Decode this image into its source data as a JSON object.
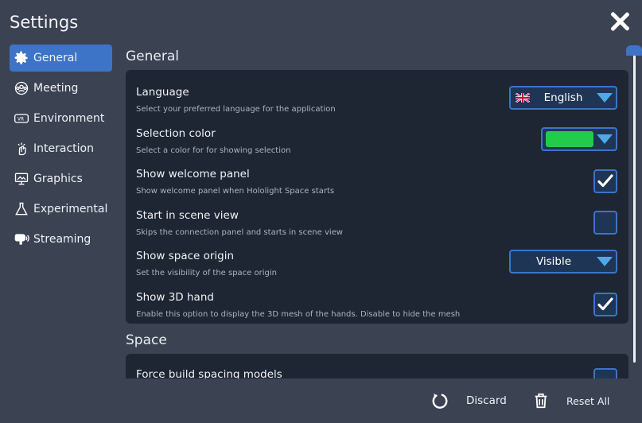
{
  "window": {
    "title": "Settings"
  },
  "sidebar": {
    "items": [
      {
        "label": "General",
        "icon": "gear-icon",
        "active": true
      },
      {
        "label": "Meeting",
        "icon": "meeting-icon"
      },
      {
        "label": "Environment",
        "icon": "vr-headset-icon"
      },
      {
        "label": "Interaction",
        "icon": "interaction-icon"
      },
      {
        "label": "Graphics",
        "icon": "monitor-icon"
      },
      {
        "label": "Experimental",
        "icon": "flask-icon"
      },
      {
        "label": "Streaming",
        "icon": "streaming-icon"
      }
    ]
  },
  "general": {
    "title": "General",
    "rows": [
      {
        "label": "Language",
        "desc": "Select your preferred language for the application",
        "control": "dropdown",
        "value": "English",
        "flag": "uk-flag-icon"
      },
      {
        "label": "Selection color",
        "desc": "Select a color for for showing selection",
        "control": "color",
        "value": "#22cc4a"
      },
      {
        "label": "Show welcome panel",
        "desc": "Show welcome panel when Hololight Space starts",
        "control": "checkbox",
        "checked": true
      },
      {
        "label": "Start in scene view",
        "desc": "Skips the connection panel and starts in scene view",
        "control": "checkbox",
        "checked": false
      },
      {
        "label": "Show space origin",
        "desc": "Set the visibility of the space origin",
        "control": "dropdown",
        "value": "Visible"
      },
      {
        "label": "Show 3D hand",
        "desc": "Enable this option to display the 3D mesh of the hands. Disable to hide the mesh",
        "control": "checkbox",
        "checked": true
      }
    ]
  },
  "space": {
    "title": "Space",
    "first_row_label": "Force build spacing models"
  },
  "footer": {
    "discard_label": "Discard",
    "reset_label": "Reset All"
  },
  "colors": {
    "accent": "#3d74c7",
    "background": "#3b4252",
    "panel": "#1e2633",
    "arrow": "#4fa9e6"
  }
}
